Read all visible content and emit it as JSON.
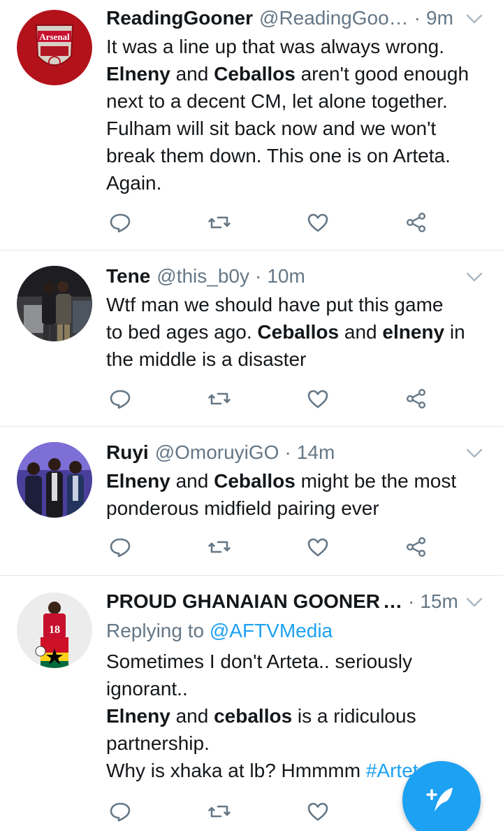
{
  "tweets": [
    {
      "name": "ReadingGooner",
      "handle": "@ReadingGoo…",
      "sep": "·",
      "time": "9m",
      "lines": [
        [
          {
            "t": "It was a line up that was always wrong."
          }
        ],
        [
          {
            "t": "Elneny",
            "b": true
          },
          {
            "t": " and "
          },
          {
            "t": "Ceballos",
            "b": true
          },
          {
            "t": " aren't good enough"
          }
        ],
        [
          {
            "t": "next to a decent CM, let alone together."
          }
        ],
        [
          {
            "t": "Fulham will sit back now and we won't"
          }
        ],
        [
          {
            "t": "break them down. This one is on Arteta."
          }
        ],
        [
          {
            "t": "Again."
          }
        ]
      ],
      "avatar_text": "Arsenal"
    },
    {
      "name": "Tene",
      "handle": "@this_b0y",
      "sep": "·",
      "time": "10m",
      "lines": [
        [
          {
            "t": "Wtf man we should have put this game"
          }
        ],
        [
          {
            "t": "to bed ages ago. "
          },
          {
            "t": "Ceballos",
            "b": true
          },
          {
            "t": " and "
          },
          {
            "t": "elneny",
            "b": true
          },
          {
            "t": " in"
          }
        ],
        [
          {
            "t": "the middle is a disaster"
          }
        ]
      ]
    },
    {
      "name": "Ruyi",
      "handle": "@OmoruyiGO",
      "sep": "·",
      "time": "14m",
      "lines": [
        [
          {
            "t": "Elneny",
            "b": true
          },
          {
            "t": " and "
          },
          {
            "t": "Ceballos",
            "b": true
          },
          {
            "t": " might be the most"
          }
        ],
        [
          {
            "t": "ponderous midfield pairing ever"
          }
        ]
      ]
    },
    {
      "name": "PROUD GHANAIAN GOONER",
      "trunc": "…",
      "sep": "·",
      "time": "15m",
      "reply_prefix": "Replying to",
      "reply_to": "@AFTVMedia",
      "lines": [
        [
          {
            "t": "Sometimes I don't Arteta.. seriously"
          }
        ],
        [
          {
            "t": "ignorant.."
          }
        ],
        [
          {
            "t": "Elneny",
            "b": true
          },
          {
            "t": " and "
          },
          {
            "t": "ceballos",
            "b": true
          },
          {
            "t": " is a ridiculous"
          }
        ],
        [
          {
            "t": "partnership."
          }
        ],
        [
          {
            "t": "Why is xhaka at lb? Hmmmm "
          },
          {
            "t": "#ArtetaOut",
            "blue": true
          }
        ]
      ],
      "avatar_text": "18"
    }
  ],
  "icons": {
    "reply": "reply-icon",
    "retweet": "retweet-icon",
    "like": "heart-icon",
    "share": "share-icon",
    "menu": "chevron-down-icon",
    "compose": "compose-tweet-icon"
  },
  "colors": {
    "accent": "#1da1f2",
    "secondary_text": "#657786",
    "divider": "#e1e8ed"
  }
}
